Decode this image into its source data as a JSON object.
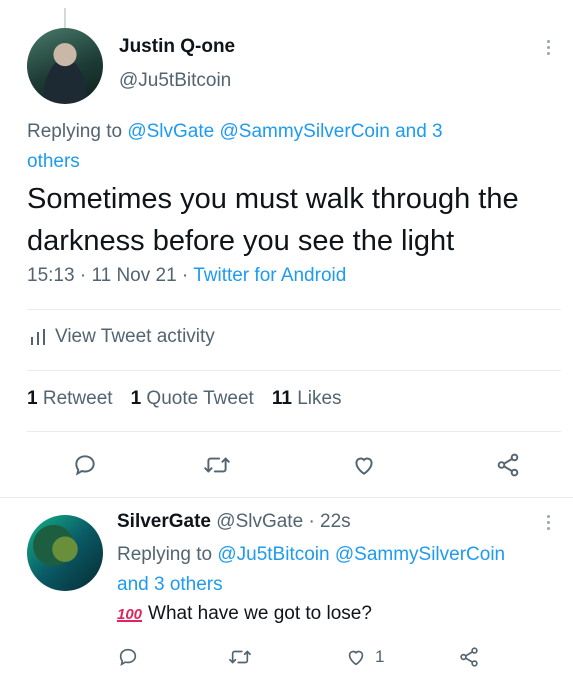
{
  "main_tweet": {
    "author_name": "Justin Q-one",
    "author_handle": "@Ju5tBitcoin",
    "replying_prefix": "Replying to",
    "replying_users": [
      "@SlvGate",
      "@SammySilverCoin"
    ],
    "replying_more": "and 3",
    "replying_more_2": "others",
    "text": "Sometimes you must walk through the darkness before you see the light",
    "time": "15:13",
    "date": "11 Nov 21",
    "source": "Twitter for Android",
    "activity_label": "View Tweet activity",
    "stats": {
      "retweets_count": "1",
      "retweets_label": "Retweet",
      "quotes_count": "1",
      "quotes_label": "Quote Tweet",
      "likes_count": "11",
      "likes_label": "Likes"
    }
  },
  "reply_tweet": {
    "author_name": "SilverGate",
    "author_handle": "@SlvGate",
    "age": "22s",
    "replying_prefix": "Replying to",
    "replying_users": [
      "@Ju5tBitcoin",
      "@SammySilverCoin"
    ],
    "replying_more": "and 3 others",
    "emoji": "100",
    "text": "What have we got to lose?",
    "like_count": "1"
  },
  "colors": {
    "link": "#1d9bf0",
    "secondary_text": "#536471",
    "primary_text": "#0f1419",
    "hundred_emoji": "#e0245e"
  },
  "icons": [
    "more-icon",
    "bar-chart-icon",
    "reply-icon",
    "retweet-icon",
    "like-icon",
    "share-icon"
  ]
}
